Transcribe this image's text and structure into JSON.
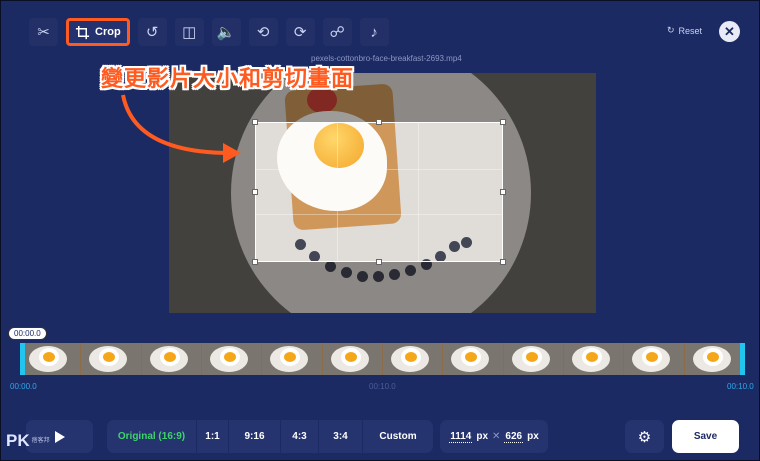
{
  "toolbar": {
    "crop_label": "Crop",
    "icons": [
      "scissors-icon",
      "crop-icon",
      "rotate-icon",
      "flip-icon",
      "volume-icon",
      "speed-icon",
      "loop-icon",
      "stabilize-icon",
      "remove-audio-icon"
    ]
  },
  "header": {
    "reset_label": "Reset",
    "close_symbol": "✕",
    "filename": "pexels-cottonbro-face-breakfast-2693.mp4"
  },
  "annotation": {
    "text": "變更影片大小和剪切畫面"
  },
  "timeline": {
    "current_time": "00:00.0",
    "start_label": "00:00.0",
    "mid_label": "00:10.0",
    "end_label": "00:10.0"
  },
  "bottom": {
    "ratios": [
      {
        "label": "Original (16:9)",
        "active": true
      },
      {
        "label": "1:1"
      },
      {
        "label": "9:16"
      },
      {
        "label": "4:3"
      },
      {
        "label": "3:4"
      },
      {
        "label": "Custom"
      }
    ],
    "width_value": "1114",
    "height_value": "626",
    "unit": "px",
    "times": "✕",
    "save_label": "Save"
  },
  "watermark": {
    "brand": "PK",
    "sub": "痞客邦"
  },
  "colors": {
    "background": "#1c2a64",
    "accent_orange": "#ff5a1f",
    "active_green": "#3fd46b",
    "timeline_handle": "#22c4f0"
  }
}
